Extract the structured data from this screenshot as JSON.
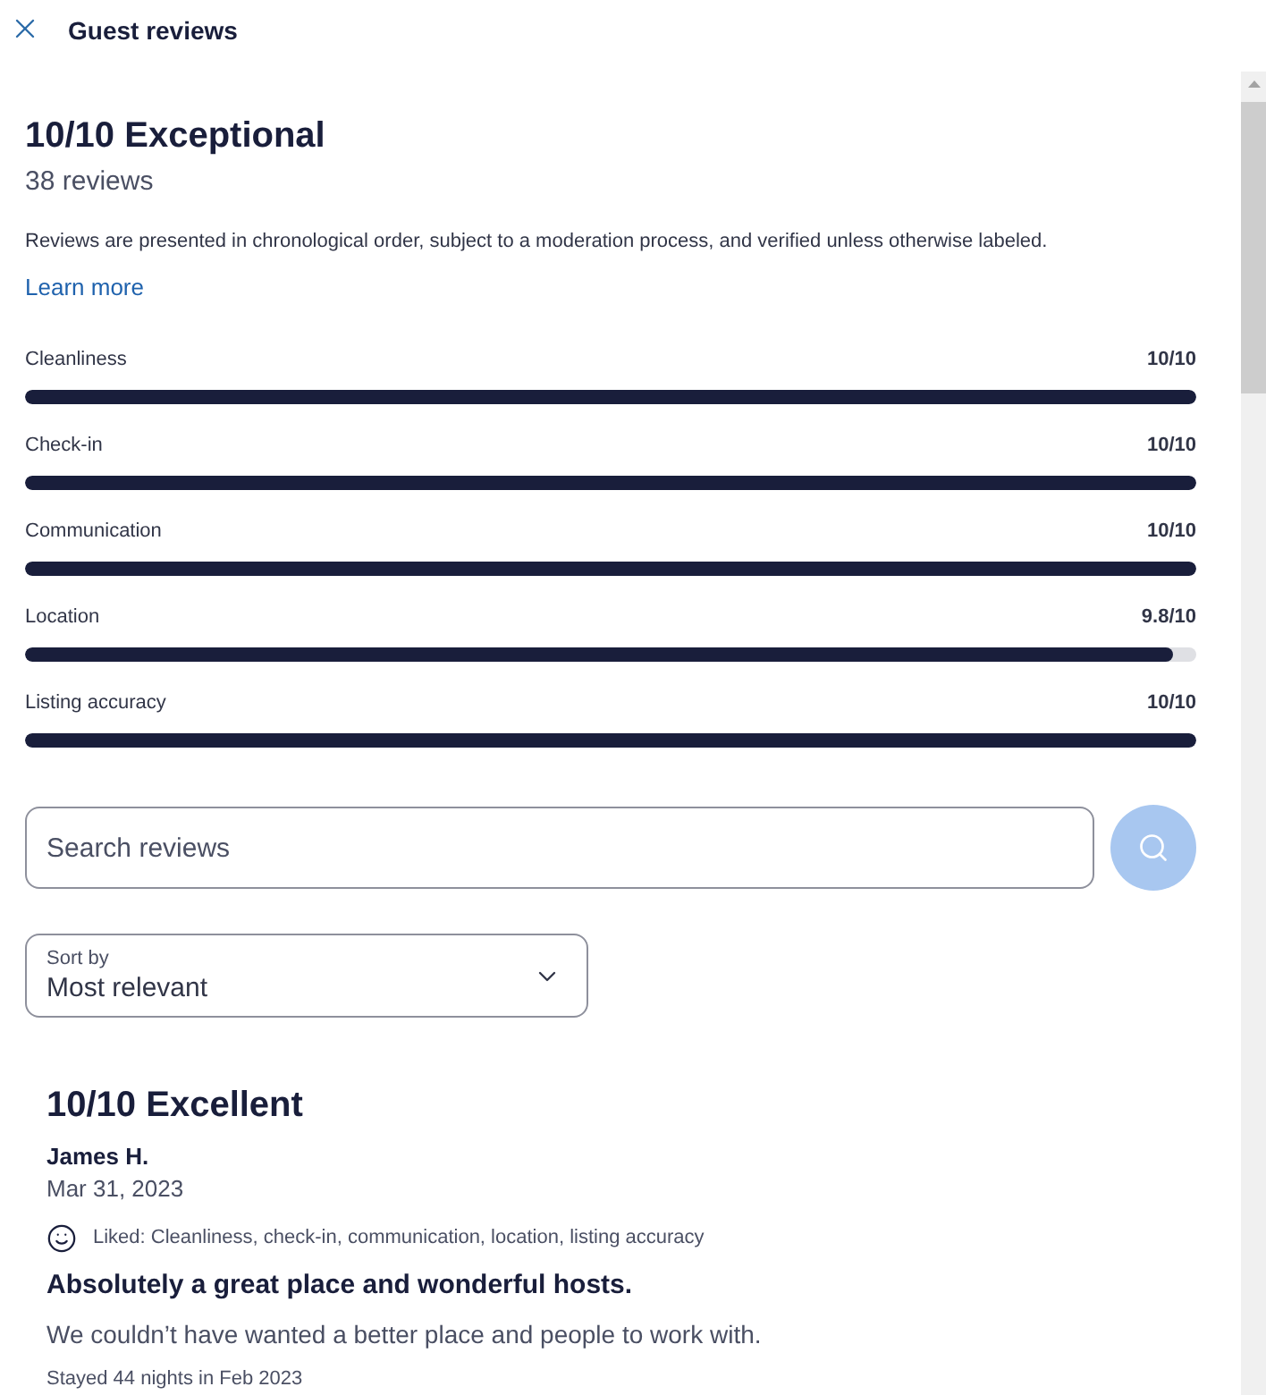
{
  "header": {
    "title": "Guest reviews"
  },
  "summary": {
    "score": "10/10 Exceptional",
    "count": "38 reviews",
    "disclaimer": "Reviews are presented in chronological order, subject to a moderation process, and verified unless otherwise labeled.",
    "link": "Learn more"
  },
  "ratings": [
    {
      "label": "Cleanliness",
      "value": "10/10",
      "level": 1
    },
    {
      "label": "Check-in",
      "value": "10/10",
      "level": 1
    },
    {
      "label": "Communication",
      "value": "10/10",
      "level": 1
    },
    {
      "label": "Location",
      "value": "9.8/10",
      "level": 0.98
    },
    {
      "label": "Listing accuracy",
      "value": "10/10",
      "level": 1
    }
  ],
  "search": {
    "placeholder": "Search reviews",
    "disabled": true
  },
  "sort": {
    "label": "Sort by",
    "value": "Most relevant"
  },
  "reviews": [
    {
      "score": "10/10 Excellent",
      "author": "James H.",
      "date": "Mar 31, 2023",
      "liked": "Liked: Cleanliness, check-in, communication, location, listing accuracy",
      "title": "Absolutely a great place and wonderful hosts.",
      "text": "We couldn’t have wanted a better place and people to work with.",
      "stay": "Stayed 44 nights in Feb 2023"
    }
  ]
}
